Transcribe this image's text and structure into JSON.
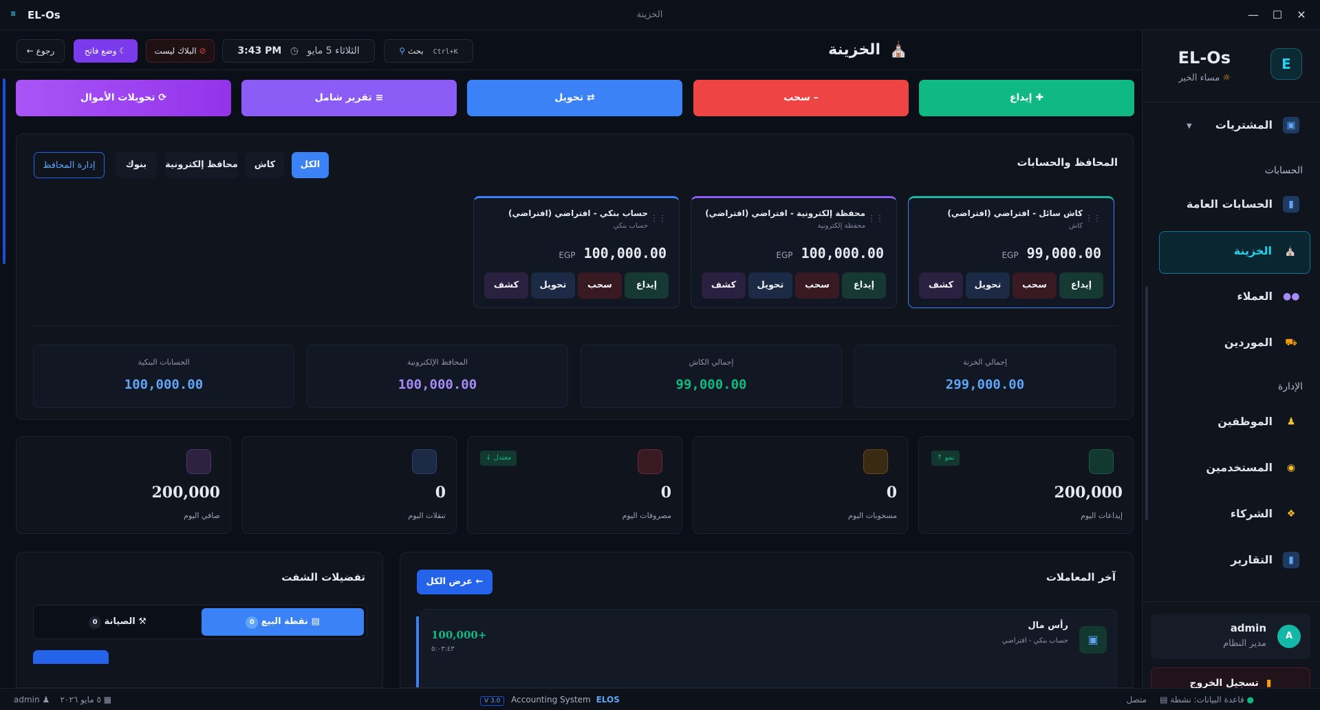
{
  "window": {
    "app_name": "EL-Os",
    "title": "الخزينة"
  },
  "sidebar": {
    "brand": "EL-Os",
    "logo_letter": "E",
    "greeting": "مساء الخير",
    "items": [
      {
        "label": "المشتريات",
        "icon": "box-icon"
      },
      {
        "label": "الحسابات العامة",
        "icon": "chart-icon"
      },
      {
        "label": "الخزينة",
        "icon": "bank-icon"
      },
      {
        "label": "العملاء",
        "icon": "users-icon"
      },
      {
        "label": "الموردين",
        "icon": "truck-icon"
      },
      {
        "label": "الموظفين",
        "icon": "employee-icon"
      },
      {
        "label": "المستخدمين",
        "icon": "lock-icon"
      },
      {
        "label": "الشركاء",
        "icon": "handshake-icon"
      },
      {
        "label": "التقارير",
        "icon": "report-icon"
      }
    ],
    "sections": {
      "accounts": "الحسابات",
      "admin": "الإدارة"
    },
    "user": {
      "name": "admin",
      "role": "مدير النظام",
      "initial": "A"
    },
    "logout": "تسجيل الخروج"
  },
  "topbar": {
    "title": "الخزينة",
    "search_label": "بحث",
    "search_shortcut": "Ctrl+K",
    "date": "الثلاثاء 5 مايو",
    "time": "3:43 PM",
    "blacklist": "البلاك ليست",
    "light_mode": "وضع فاتح",
    "back": "رجوع"
  },
  "actions": {
    "deposit": "إيداع",
    "withdraw": "سحب",
    "transfer": "تحويل",
    "report": "تقرير شامل",
    "money_transfers": "تحويلات الأموال"
  },
  "wallets": {
    "title": "المحافظ والحسابات",
    "filters": [
      "الكل",
      "كاش",
      "محافظ إلكترونية",
      "بنوك"
    ],
    "manage": "إدارة المحافظ",
    "currency": "EGP",
    "btn_deposit": "إيداع",
    "btn_withdraw": "سحب",
    "btn_transfer": "تحويل",
    "btn_statement": "كشف",
    "cards": [
      {
        "name": "كاش سائل - افتراضي (افتراضي)",
        "type": "كاش",
        "balance": "99,000.00"
      },
      {
        "name": "محفظة إلكترونية - افتراضي (افتراضي)",
        "type": "محفظة إلكترونية",
        "balance": "100,000.00"
      },
      {
        "name": "حساب بنكي - افتراضي (افتراضي)",
        "type": "حساب بنكي",
        "balance": "100,000.00"
      }
    ],
    "totals": [
      {
        "label": "إجمالي الخزنة",
        "value": "299,000.00"
      },
      {
        "label": "إجمالي الكاش",
        "value": "99,000.00"
      },
      {
        "label": "المحافظ الإلكترونية",
        "value": "100,000.00"
      },
      {
        "label": "الحسابات البنكية",
        "value": "100,000.00"
      }
    ]
  },
  "stats": [
    {
      "label": "إيداعات اليوم",
      "value": "200,000",
      "tag": "↑ نمو"
    },
    {
      "label": "مسحوبات اليوم",
      "value": "0",
      "tag": ""
    },
    {
      "label": "مصروفات اليوم",
      "value": "0",
      "tag": "↓ معتدل"
    },
    {
      "label": "تنقلات اليوم",
      "value": "0",
      "tag": ""
    },
    {
      "label": "صافي اليوم",
      "value": "200,000",
      "tag": ""
    }
  ],
  "transactions": {
    "title": "آخر المعاملات",
    "view_all": "عرض الكل",
    "items": [
      {
        "title": "رأس مال",
        "account": "حساب بنكي - افتراضي",
        "amount": "100,000+",
        "time": "٥:٠٣:٤٣"
      }
    ]
  },
  "shift": {
    "title": "تفضيلات الشفت",
    "tabs": [
      {
        "label": "نقطة البيع",
        "count": "0"
      },
      {
        "label": "الصيانة",
        "count": "0"
      }
    ]
  },
  "statusbar": {
    "connected": "متصل",
    "db": "قاعدة البيانات: نشطة",
    "system_brand": "ELOS",
    "system_name": "Accounting System",
    "version": "V 3.0",
    "date": "٥ مايو ٢٠٢٦",
    "user": "admin"
  },
  "colors": {
    "accent": "#22d3ee",
    "green": "#10b981",
    "red": "#ef4444",
    "blue": "#3b82f6",
    "purple": "#8b5cf6"
  }
}
